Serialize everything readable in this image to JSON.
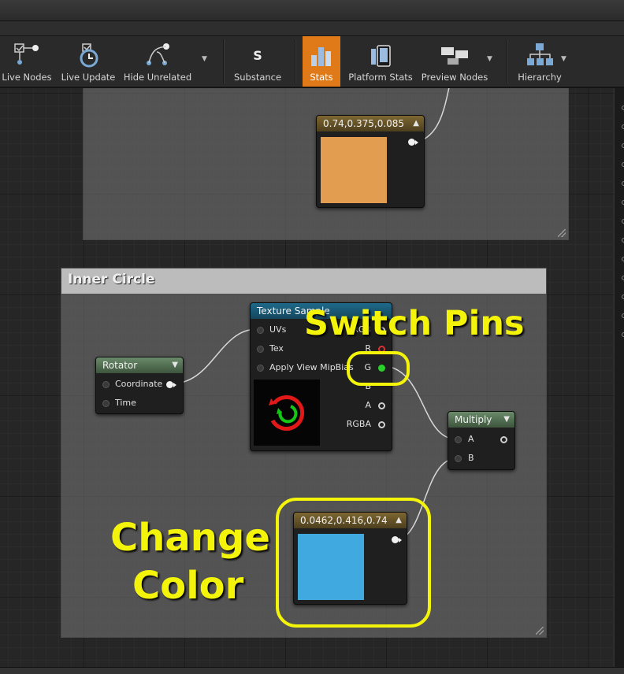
{
  "toolbar": {
    "live_nodes": "Live Nodes",
    "live_update": "Live Update",
    "hide_unrelated": "Hide Unrelated",
    "substance": "Substance",
    "stats": "Stats",
    "platform_stats": "Platform Stats",
    "preview_nodes": "Preview Nodes",
    "hierarchy": "Hierarchy",
    "active_item": "Stats"
  },
  "colors": {
    "accent": "#e07a18",
    "annotation": "#f4f40a",
    "orange_swatch": "#e29d50",
    "blue_swatch": "#3fa9e0"
  },
  "nodes": {
    "constant_top": {
      "title": "0.74,0.375,0.085"
    },
    "comment_inner": {
      "title": "Inner Circle"
    },
    "texture_sample": {
      "title": "Texture Sample",
      "inputs": [
        "UVs",
        "Tex",
        "Apply View MipBias"
      ],
      "outputs": [
        "RGB",
        "R",
        "G",
        "B",
        "A",
        "RGBA"
      ]
    },
    "rotator": {
      "title": "Rotator",
      "inputs": [
        "Coordinate",
        "Time"
      ]
    },
    "multiply": {
      "title": "Multiply",
      "inputs": [
        "A",
        "B"
      ]
    },
    "constant_blue": {
      "title": "0.0462,0.416,0.74"
    }
  },
  "annotations": {
    "switch_pins": "Switch Pins",
    "change_color_line1": "Change",
    "change_color_line2": "Color"
  }
}
